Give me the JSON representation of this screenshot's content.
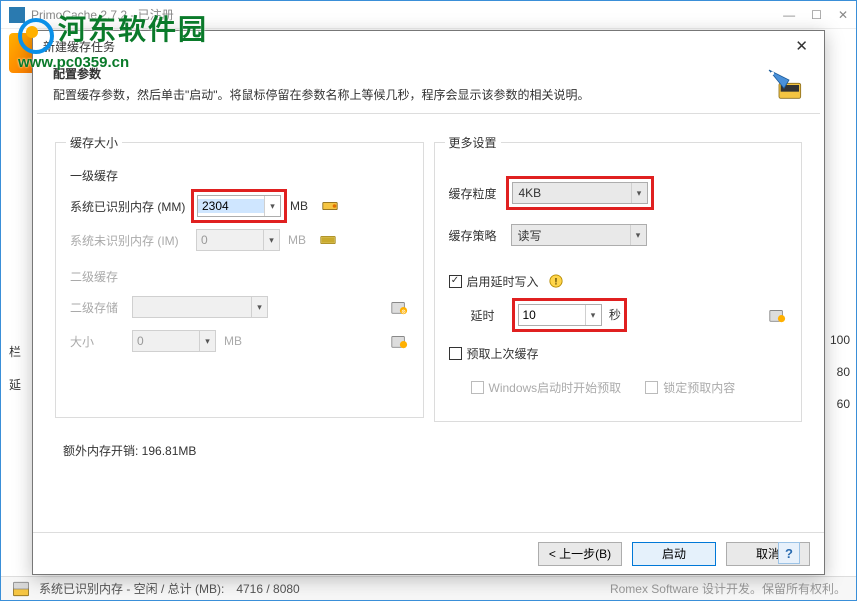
{
  "parent": {
    "title": "PrimoCache 2.7.2 - 已注册",
    "statusbar_left": "系统已识别内存 - 空闲 / 总计 (MB):",
    "statusbar_values": "4716 / 8080",
    "statusbar_right": "Romex Software 设计开发。保留所有权利。",
    "side_nums": [
      "100",
      "80",
      "60"
    ],
    "side_left": [
      "栏",
      "延"
    ]
  },
  "watermark": {
    "line1": "河东软件园",
    "line2": "www.pc0359.cn"
  },
  "dialog": {
    "title": "新建缓存任务",
    "header_title": "配置参数",
    "header_desc": "配置缓存参数，然后单击\"启动\"。将鼠标停留在参数名称上等候几秒，程序会显示该参数的相关说明。",
    "left": {
      "group_title": "缓存大小",
      "l1_title": "一级缓存",
      "row_mm_label": "系统已识别内存 (MM)",
      "row_mm_value": "2304",
      "row_mm_unit": "MB",
      "row_im_label": "系统未识别内存 (IM)",
      "row_im_value": "0",
      "row_im_unit": "MB",
      "l2_title": "二级缓存",
      "row_storage_label": "二级存储",
      "row_storage_value": "",
      "row_size_label": "大小",
      "row_size_value": "0",
      "row_size_unit": "MB",
      "extra_overhead": "额外内存开销: 196.81MB"
    },
    "right": {
      "group_title": "更多设置",
      "row_gran_label": "缓存粒度",
      "row_gran_value": "4KB",
      "row_strategy_label": "缓存策略",
      "row_strategy_value": "读写",
      "chk_defer": "启用延时写入",
      "row_delay_label": "延时",
      "row_delay_value": "10",
      "row_delay_unit": "秒",
      "chk_prefetch": "预取上次缓存",
      "chk_prefetch_boot": "Windows启动时开始预取",
      "chk_lock_prefetch": "锁定预取内容"
    },
    "footer": {
      "back": "< 上一步(B)",
      "start": "启动",
      "cancel": "取消"
    }
  }
}
